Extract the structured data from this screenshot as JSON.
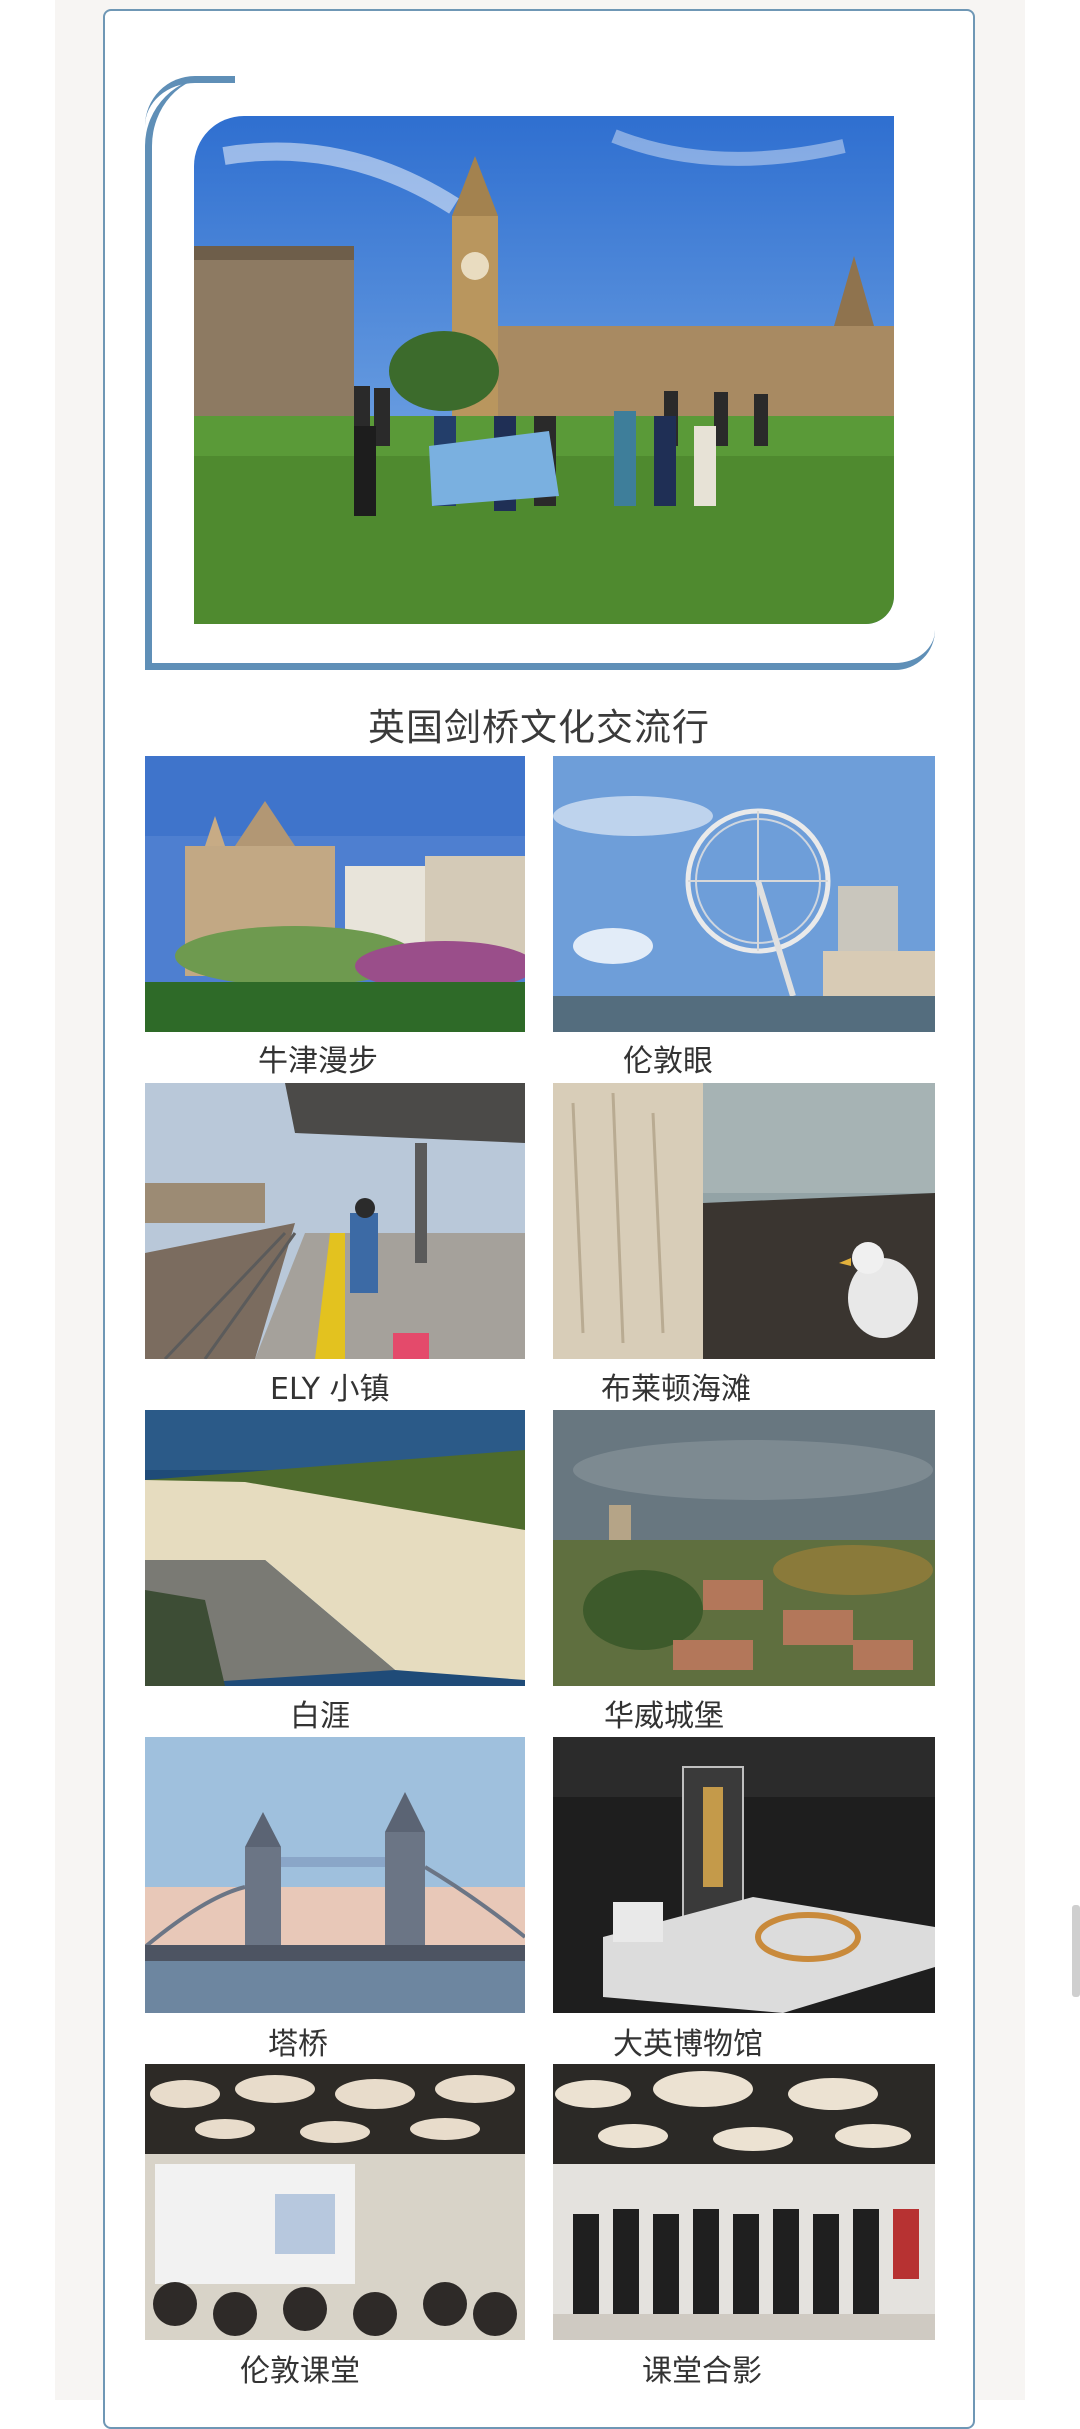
{
  "hero": {
    "alt": "group-photo-big-ben"
  },
  "title": "英国剑桥文化交流行",
  "gallery": [
    {
      "caption": "牛津漫步"
    },
    {
      "caption": "伦敦眼"
    },
    {
      "caption": "ELY 小镇"
    },
    {
      "caption": "布莱顿海滩"
    },
    {
      "caption": "白涯"
    },
    {
      "caption": "华威城堡"
    },
    {
      "caption": "塔桥"
    },
    {
      "caption": "大英博物馆"
    },
    {
      "caption": "伦敦课堂"
    },
    {
      "caption": "课堂合影"
    }
  ],
  "colors": {
    "frame_blue": "#5f8fb7",
    "card_border": "#6f97b5",
    "page_bg": "#f7f5f3"
  }
}
